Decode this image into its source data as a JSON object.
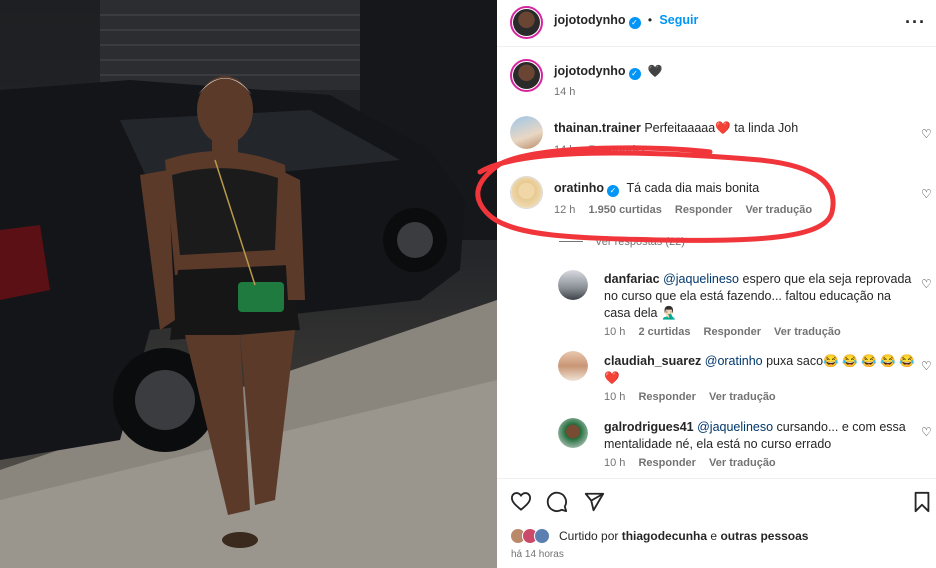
{
  "header": {
    "username": "jojotodynho",
    "separator": "•",
    "follow_label": "Seguir",
    "more_icon": "more-horizontal-icon"
  },
  "caption": {
    "username": "jojotodynho",
    "text": "🖤",
    "time": "14 h"
  },
  "comments": [
    {
      "username": "thainan.trainer",
      "text": "Perfeitaaaaa❤️ ta linda Joh",
      "time": "14 h",
      "reply_label": "Responder"
    },
    {
      "username": "oratinho",
      "text": "Tá cada dia mais bonita",
      "time": "12 h",
      "likes": "1.950 curtidas",
      "reply_label": "Responder",
      "translate_label": "Ver tradução",
      "view_replies_label": "Ver respostas (22)"
    }
  ],
  "replies": [
    {
      "username": "danfariac",
      "mention": "@jaquelineso",
      "text_line1": " espero que ela seja reprovada",
      "text_line2": "no curso que ela está fazendo... faltou educação na",
      "text_line3": "casa dela 🤦🏻‍♂️",
      "time": "10 h",
      "likes": "2 curtidas",
      "reply_label": "Responder",
      "translate_label": "Ver tradução"
    },
    {
      "username": "claudiah_suarez",
      "mention": "@oratinho",
      "text_line1": " puxa saco😂 😂 😂 😂 😂",
      "text_line2": "❤️",
      "time": "10 h",
      "reply_label": "Responder",
      "translate_label": "Ver tradução"
    },
    {
      "username": "galrodrigues41",
      "mention": "@jaquelineso",
      "text_line1": " cursando... e com essa",
      "text_line2": "mentalidade né, ela está no curso errado",
      "time": "10 h",
      "reply_label": "Responder",
      "translate_label": "Ver tradução"
    }
  ],
  "footer": {
    "liked_prefix": "Curtido por",
    "liked_user": "thiagodecunha",
    "liked_mid": "e",
    "liked_others": "outras pessoas",
    "posted_ago": "há 14 horas"
  },
  "colors": {
    "link_blue": "#0095f6",
    "annotation_red": "#f0363a",
    "mention": "#00376b"
  }
}
